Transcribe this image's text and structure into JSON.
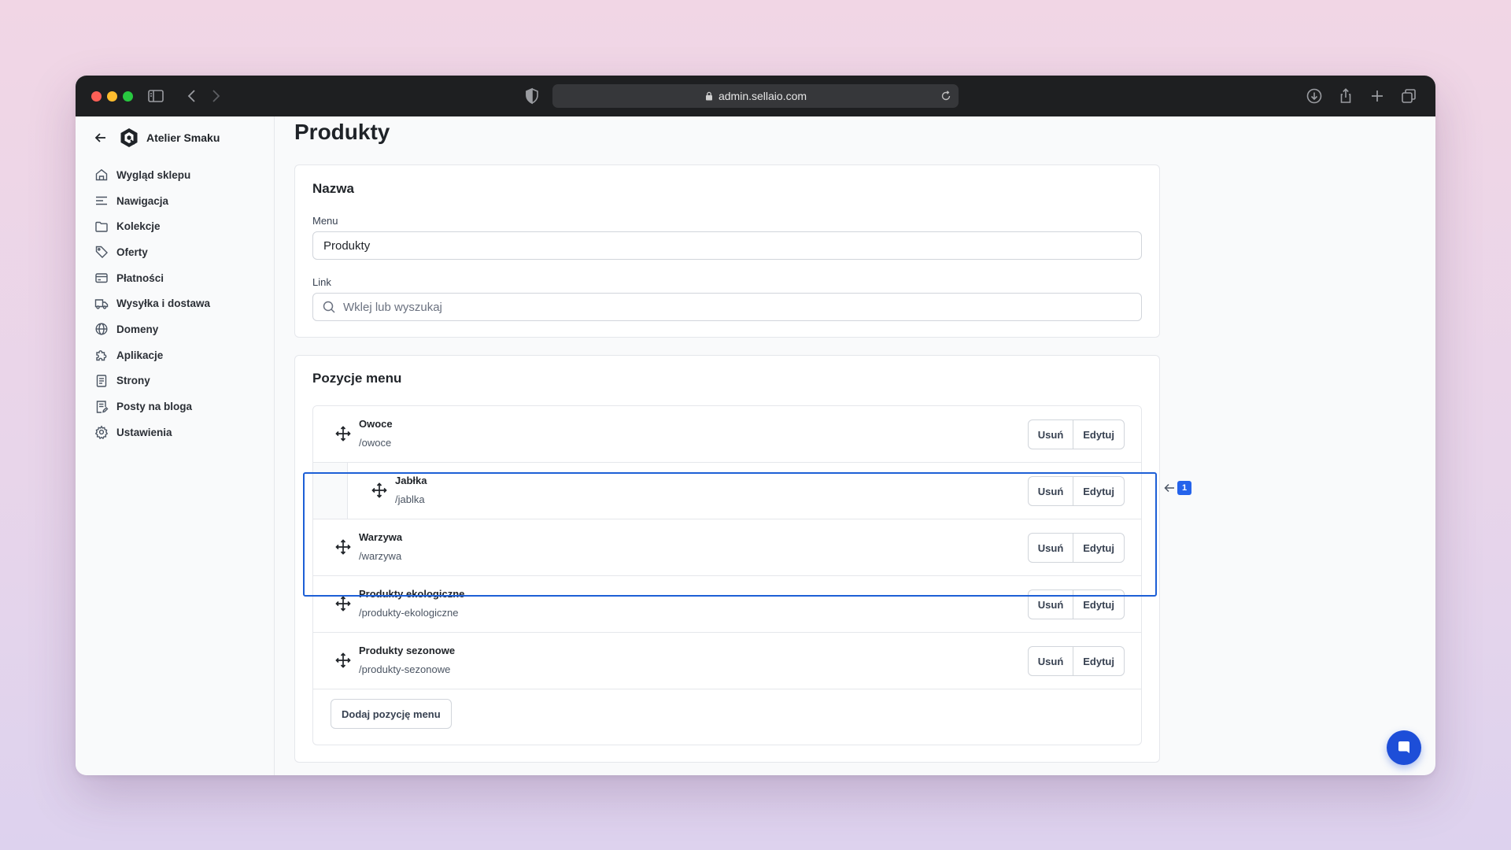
{
  "browser": {
    "url": "admin.sellaio.com"
  },
  "sidebar": {
    "store_name": "Atelier Smaku",
    "items": [
      {
        "label": "Wygląd sklepu",
        "icon": "storefront-icon"
      },
      {
        "label": "Nawigacja",
        "icon": "menu-lines-icon"
      },
      {
        "label": "Kolekcje",
        "icon": "folder-icon"
      },
      {
        "label": "Oferty",
        "icon": "tag-icon"
      },
      {
        "label": "Płatności",
        "icon": "credit-card-icon"
      },
      {
        "label": "Wysyłka i dostawa",
        "icon": "truck-icon"
      },
      {
        "label": "Domeny",
        "icon": "globe-icon"
      },
      {
        "label": "Aplikacje",
        "icon": "puzzle-icon"
      },
      {
        "label": "Strony",
        "icon": "page-icon"
      },
      {
        "label": "Posty na bloga",
        "icon": "blog-post-icon"
      },
      {
        "label": "Ustawienia",
        "icon": "gear-icon"
      }
    ]
  },
  "page": {
    "title": "Produkty"
  },
  "name_card": {
    "title": "Nazwa",
    "menu_label": "Menu",
    "menu_value": "Produkty",
    "link_label": "Link",
    "link_placeholder": "Wklej lub wyszukaj"
  },
  "menu_items_card": {
    "title": "Pozycje menu",
    "remove_label": "Usuń",
    "edit_label": "Edytuj",
    "items": [
      {
        "title": "Owoce",
        "slug": "/owoce"
      },
      {
        "title": "Jabłka",
        "slug": "/jablka"
      },
      {
        "title": "Warzywa",
        "slug": "/warzywa"
      },
      {
        "title": "Produkty ekologiczne",
        "slug": "/produkty-ekologiczne"
      },
      {
        "title": "Produkty sezonowe",
        "slug": "/produkty-sezonowe"
      }
    ],
    "add_button": "Dodaj pozycję menu"
  },
  "annotation": {
    "badge": "1"
  },
  "colors": {
    "accent": "#2563eb",
    "highlight_border": "#1d5fd6",
    "titlebar": "#1e1f21"
  }
}
